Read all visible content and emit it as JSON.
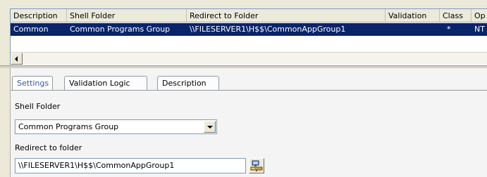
{
  "grid": {
    "columns": [
      "Description",
      "Shell Folder",
      "Redirect to Folder",
      "Validation",
      "Class",
      "Op"
    ],
    "rows": [
      {
        "description": "Common",
        "shell_folder": "Common Programs Group",
        "redirect": "\\\\FILESERVER1\\H$$\\CommonAppGroup1",
        "validation": "",
        "class": "*",
        "op": "NT"
      }
    ]
  },
  "tabs": [
    {
      "label": "Settings",
      "active": true
    },
    {
      "label": "Validation Logic",
      "active": false
    },
    {
      "label": "Description",
      "active": false
    }
  ],
  "settings": {
    "shell_folder_label": "Shell Folder",
    "shell_folder_value": "Common Programs Group",
    "redirect_label": "Redirect to folder",
    "redirect_value": "\\\\FILESERVER1\\H$$\\CommonAppGroup1"
  },
  "colors": {
    "selection": "#0a246a",
    "window_bg": "#ece9d8",
    "tab_label": "#3a5da0"
  }
}
